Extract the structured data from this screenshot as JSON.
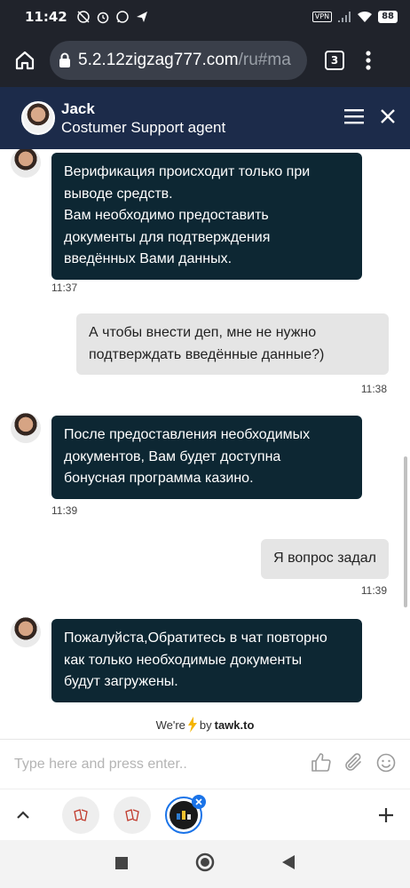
{
  "status_bar": {
    "time": "11:42",
    "vpn": "VPN",
    "battery": "88"
  },
  "browser": {
    "url_host": "5.2.12zigzag777.com",
    "url_path": "/ru#ma",
    "tab_count": "3"
  },
  "chat_header": {
    "agent_name": "Jack",
    "agent_role": "Costumer Support agent"
  },
  "messages": [
    {
      "sender": "agent",
      "lines": [
        "Верификация происходит только при",
        "выводе средств.",
        "Вам необходимо предоставить",
        "документы для подтверждения",
        "введённых Вами данных."
      ],
      "time": "11:37"
    },
    {
      "sender": "user",
      "lines": [
        "А чтобы внести деп, мне не нужно",
        "подтверждать введённые данные?)"
      ],
      "time": "11:38"
    },
    {
      "sender": "agent",
      "lines": [
        "После предоставления необходимых",
        "документов, Вам будет доступна",
        "бонусная программа казино."
      ],
      "time": "11:39"
    },
    {
      "sender": "user",
      "lines": [
        "Я вопрос задал"
      ],
      "time": "11:39"
    },
    {
      "sender": "agent",
      "lines": [
        "Пожалуйста,Обратитесь в чат повторно",
        "как только необходимые документы",
        "будут загружены."
      ],
      "time": ""
    }
  ],
  "powered_by": {
    "prefix": "We're",
    "by": "by",
    "brand": "tawk.to"
  },
  "composer": {
    "placeholder": "Type here and press enter.."
  },
  "colors": {
    "header_bg": "#1c2b4a",
    "agent_bubble": "#0d2733",
    "user_bubble": "#e5e5e5",
    "accent": "#1a73e8"
  }
}
